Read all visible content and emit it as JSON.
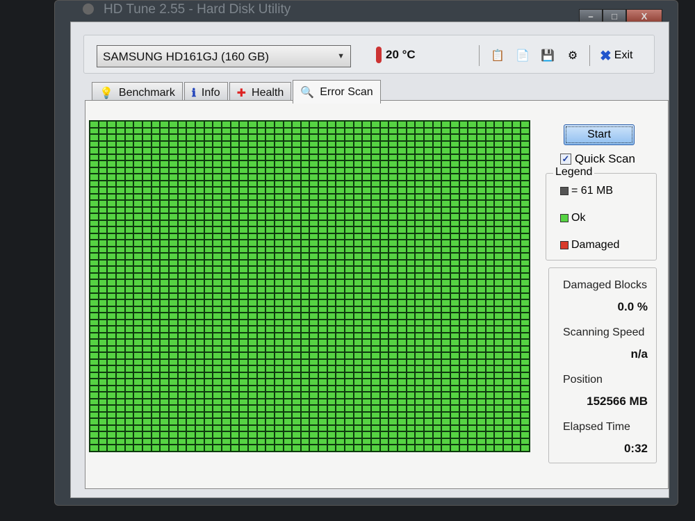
{
  "window": {
    "title": "HD Tune 2.55 - Hard Disk Utility",
    "minimize": "–",
    "maximize": "□",
    "close": "X"
  },
  "toolbar": {
    "drive": "SAMSUNG HD161GJ (160 GB)",
    "temperature": "20 °C",
    "exit_label": "Exit",
    "tools": [
      {
        "icon": "copy-info-icon",
        "glyph": "📋"
      },
      {
        "icon": "copy-screenshot-icon",
        "glyph": "📄"
      },
      {
        "icon": "save-icon",
        "glyph": "💾"
      },
      {
        "icon": "options-icon",
        "glyph": "⚙"
      }
    ]
  },
  "tabs": [
    {
      "label": "Benchmark",
      "icon": "lightbulb-icon",
      "glyph": "💡"
    },
    {
      "label": "Info",
      "icon": "info-icon",
      "glyph": "ℹ"
    },
    {
      "label": "Health",
      "icon": "health-cross-icon",
      "glyph": "✚"
    },
    {
      "label": "Error Scan",
      "icon": "magnifier-icon",
      "glyph": "🔍",
      "active": true
    }
  ],
  "scan": {
    "start_label": "Start",
    "quick_scan_label": "Quick Scan",
    "quick_scan_checked": true,
    "grid": {
      "columns": 50,
      "rows": 50,
      "block_status": "ok"
    },
    "legend": {
      "title": "Legend",
      "block_size": "= 61 MB",
      "ok": "Ok",
      "damaged": "Damaged",
      "colors": {
        "block": "#555555",
        "ok": "#56d343",
        "damaged": "#d83a2a"
      }
    },
    "stats": {
      "damaged_blocks_label": "Damaged Blocks",
      "damaged_blocks": "0.0 %",
      "speed_label": "Scanning Speed",
      "speed": "n/a",
      "position_label": "Position",
      "position": "152566 MB",
      "elapsed_label": "Elapsed Time",
      "elapsed": "0:32"
    }
  }
}
